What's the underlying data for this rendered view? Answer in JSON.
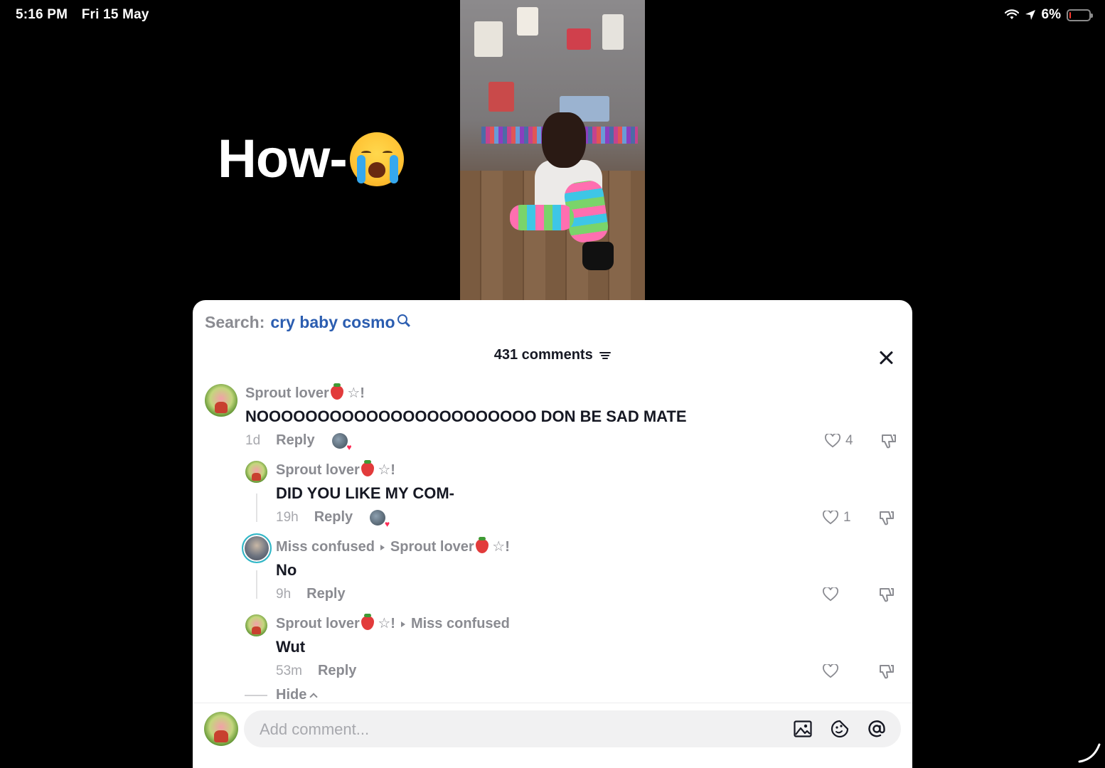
{
  "status_bar": {
    "time": "5:16 PM",
    "date": "Fri 15 May",
    "battery": "6%",
    "battery_level": 0.06
  },
  "video": {
    "caption": "How-"
  },
  "panel": {
    "search_label": "Search:",
    "search_term": "cry baby cosmo",
    "comments_count": "431 comments",
    "comments": [
      {
        "name": "Sprout lover",
        "name_suffix": "☆!",
        "text": "NOOOOOOOOOOOOOOOOOOOOOOO DON BE SAD MATE",
        "time": "1d",
        "reply": "Reply",
        "likes": "4"
      },
      {
        "name": "Sprout lover",
        "name_suffix": "☆!",
        "text": "DID YOU LIKE MY COM-",
        "time": "19h",
        "reply": "Reply",
        "likes": "1"
      },
      {
        "name": "Miss confused",
        "reply_to": "Sprout lover",
        "reply_to_suffix": "☆!",
        "text": "No",
        "time": "9h",
        "reply": "Reply",
        "likes": ""
      },
      {
        "name": "Sprout lover",
        "name_suffix": "☆!",
        "reply_to": "Miss confused",
        "text": "Wut",
        "time": "53m",
        "reply": "Reply",
        "likes": ""
      }
    ],
    "hide_label": "Hide",
    "input_placeholder": "Add comment..."
  },
  "icons": [
    "search-icon",
    "filter-icon",
    "close-icon",
    "heart-icon",
    "dislike-icon",
    "image-icon",
    "emoji-icon",
    "mention-icon",
    "wifi-icon",
    "location-icon",
    "battery-icon"
  ],
  "colors": {
    "accent_blue": "#2b5db0",
    "like_pink": "#fe2c55",
    "ring_cyan": "#2fb8c8"
  }
}
